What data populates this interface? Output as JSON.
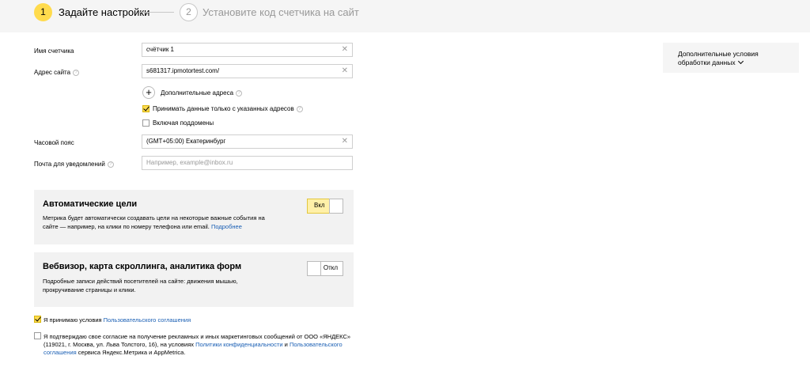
{
  "stepper": {
    "step1": {
      "number": "1",
      "label": "Задайте настройки"
    },
    "step2": {
      "number": "2",
      "label": "Установите код счетчика на сайт"
    }
  },
  "form": {
    "counter_name": {
      "label": "Имя счетчика",
      "value": "счётчик 1"
    },
    "site_address": {
      "label": "Адрес сайта",
      "value": "s681317.ipmotortest.com/"
    },
    "add_addresses_label": "Дополнительные адреса",
    "accept_only_listed": {
      "label": "Принимать данные только с указанных адресов",
      "checked": true
    },
    "include_subdomains": {
      "label": "Включая поддомены",
      "checked": false
    },
    "timezone": {
      "label": "Часовой пояс",
      "value": "(GMT+05:00) Екатеринбург"
    },
    "notify_email": {
      "label": "Почта для уведомлений",
      "placeholder": "Например, example@inbox.ru"
    }
  },
  "auto_goals": {
    "title": "Автоматические цели",
    "desc": "Метрика будет автоматически создавать цели на некоторые важные события на сайте — например, на клики по номеру телефона или email.",
    "link": "Подробнее",
    "toggle_label": "Вкл",
    "enabled": true
  },
  "webvisor": {
    "title": "Вебвизор, карта скроллинга, аналитика форм",
    "desc": "Подробные записи действий посетителей на сайте: движения мышью, прокручивание страницы и клики.",
    "toggle_label": "Откл",
    "enabled": false
  },
  "agreement": {
    "prefix": "Я принимаю условия ",
    "link": "Пользовательского соглашения",
    "checked": true
  },
  "marketing_consent": {
    "text1": "Я подтверждаю свое согласие на получение рекламных и иных маркетинговых сообщений от ООО «ЯНДЕКС» (119021, г. Москва, ул. Льва Толстого, 16), на условиях ",
    "link1": "Политики конфиденциальности",
    "and": " и ",
    "link2": "Пользовательского соглашения",
    "text2": " сервиса Яндекс.Метрика и AppMetrica.",
    "checked": false
  },
  "sidebar": {
    "extra_terms": "Дополнительные условия обработки данных"
  },
  "colors": {
    "accent": "#ffdb4d",
    "link": "#1a5fb4",
    "panel_bg": "#f2f2f2"
  },
  "icons": [
    "clear-icon",
    "help-icon",
    "plus-icon",
    "checkmark-icon",
    "chevron-down-icon"
  ]
}
